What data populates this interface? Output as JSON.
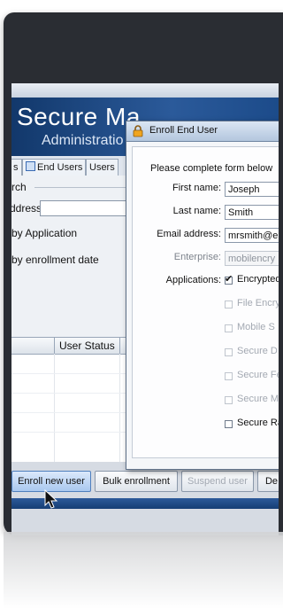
{
  "app": {
    "title": "Secure Ma",
    "subtitle": "Administratio"
  },
  "tabs": [
    {
      "label": "s"
    },
    {
      "label": "End Users"
    },
    {
      "label": "Users"
    }
  ],
  "panel": {
    "group_label": "rch",
    "address_label": "ddress:",
    "address_value": "",
    "by_application": "by Application",
    "by_enrollment_date": "by enrollment date"
  },
  "table": {
    "columns": [
      "",
      "User Status"
    ]
  },
  "buttons": {
    "enroll": "Enroll new user",
    "bulk": "Bulk enrollment",
    "suspend": "Suspend user",
    "more": "De"
  },
  "dialog": {
    "title": "Enroll End User",
    "intro": "Please complete form below",
    "first_name_label": "First name:",
    "first_name_value": "Joseph",
    "last_name_label": "Last name:",
    "last_name_value": "Smith",
    "email_label": "Email address:",
    "email_value": "mrsmith@e",
    "enterprise_label": "Enterprise:",
    "enterprise_value": "mobilencry",
    "applications_label": "Applications:",
    "applications": [
      {
        "label": "Encrypted",
        "checked": true,
        "enabled": true
      },
      {
        "label": "File Encry",
        "checked": false,
        "enabled": false
      },
      {
        "label": "Mobile S",
        "checked": false,
        "enabled": false
      },
      {
        "label": "Secure D",
        "checked": false,
        "enabled": false
      },
      {
        "label": "Secure Fe",
        "checked": false,
        "enabled": false
      },
      {
        "label": "Secure M",
        "checked": false,
        "enabled": false
      },
      {
        "label": "Secure Ra",
        "checked": false,
        "enabled": true
      }
    ]
  },
  "colors": {
    "banner": "#1c4b8a",
    "frame": "#2a2d33",
    "primary_button": "#a9c8ef"
  },
  "icons": {
    "dialog_icon": "lock-icon",
    "pointer": "mouse-cursor-icon"
  }
}
